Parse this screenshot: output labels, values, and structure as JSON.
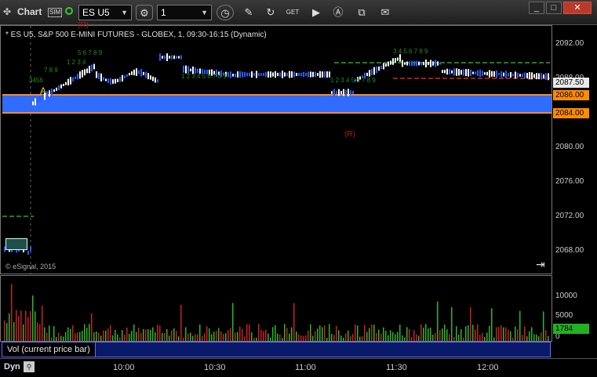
{
  "toolbar": {
    "app_title": "Chart",
    "sim_badge": "SIM",
    "symbol": "ES U5",
    "interval": "1"
  },
  "window": {
    "minimize": "_",
    "maximize": "□",
    "close": "✕"
  },
  "chart": {
    "title": "* ES U5, S&P 500 E-MINI FUTURES - GLOBEX, 1, 09:30-16:15 (Dynamic)",
    "copyright": "© eSignal, 2015",
    "marker_r": "(R)",
    "marker_r_top": "(R)",
    "marker_a": "A",
    "price_labels": [
      "2092.00",
      "2088.00",
      "2084.00",
      "2080.00",
      "2076.00",
      "2072.00",
      "2068.00"
    ],
    "last_price": "2087.50",
    "band_top": "2086.00",
    "band_bottom": "2084.00",
    "colors": {
      "up": "#ffffff",
      "down": "#2a5cff",
      "band": "#2f6cff",
      "band_edge": "#f28c28",
      "tag_orange": "#ff8c00",
      "vol_tag": "#22b122"
    }
  },
  "volume": {
    "label": "Vol (current price bar)",
    "axis_labels": [
      "10000",
      "5000",
      "0"
    ],
    "last": "1784"
  },
  "time_axis": {
    "dyn_label": "Dyn",
    "labels": [
      "10:00",
      "10:30",
      "11:00",
      "11:30",
      "12:00"
    ]
  },
  "chart_data": {
    "type": "candlestick",
    "x": [
      "10:00",
      "10:30",
      "11:00",
      "11:30",
      "12:00"
    ],
    "ylim": [
      2066,
      2094
    ],
    "reference_levels": [
      2086.0,
      2084.0
    ],
    "last_price": 2087.5,
    "volume_last": 1784
  }
}
